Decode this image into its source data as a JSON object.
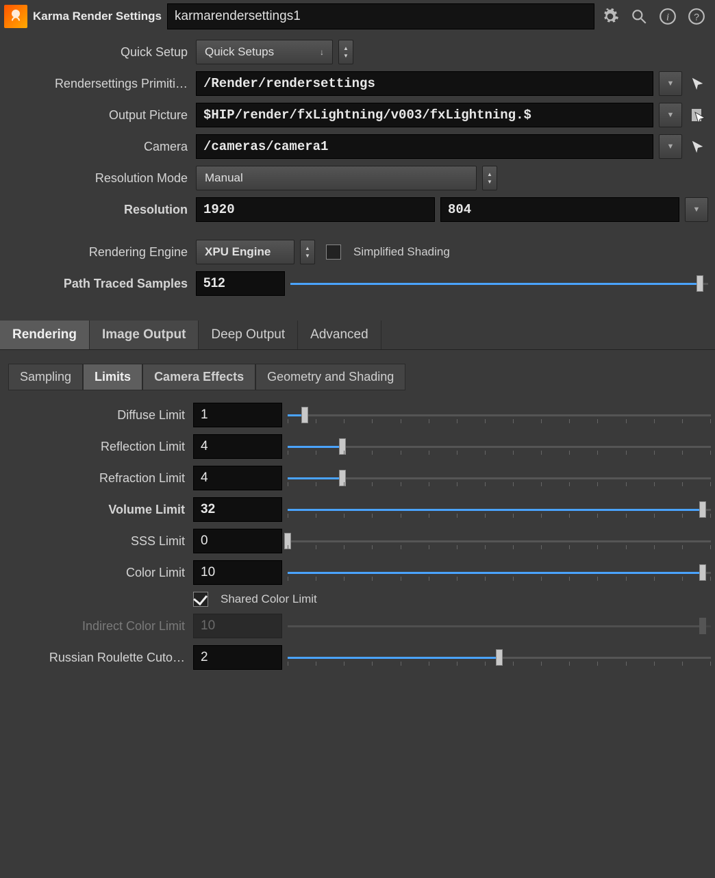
{
  "header": {
    "title": "Karma Render Settings",
    "node_name": "karmarendersettings1"
  },
  "params": {
    "quick_setup_label": "Quick Setup",
    "quick_setup_value": "Quick Setups",
    "rendersettings_label": "Rendersettings Primiti…",
    "rendersettings_value": "/Render/rendersettings",
    "output_picture_label": "Output Picture",
    "output_picture_value": "$HIP/render/fxLightning/v003/fxLightning.$",
    "camera_label": "Camera",
    "camera_value": "/cameras/camera1",
    "resolution_mode_label": "Resolution Mode",
    "resolution_mode_value": "Manual",
    "resolution_label": "Resolution",
    "resolution_x": "1920",
    "resolution_y": "804",
    "rendering_engine_label": "Rendering Engine",
    "rendering_engine_value": "XPU Engine",
    "simplified_shading_label": "Simplified Shading",
    "path_traced_label": "Path Traced Samples",
    "path_traced_value": "512",
    "path_traced_pct": 98
  },
  "tabs": [
    "Rendering",
    "Image Output",
    "Deep Output",
    "Advanced"
  ],
  "active_tab": "Rendering",
  "subtabs": [
    "Sampling",
    "Limits",
    "Camera Effects",
    "Geometry and Shading"
  ],
  "active_subtab": "Limits",
  "limits": {
    "diffuse": {
      "label": "Diffuse Limit",
      "value": "1",
      "pct": 4,
      "bold": false
    },
    "reflection": {
      "label": "Reflection Limit",
      "value": "4",
      "pct": 13,
      "bold": false
    },
    "refraction": {
      "label": "Refraction Limit",
      "value": "4",
      "pct": 13,
      "bold": false
    },
    "volume": {
      "label": "Volume Limit",
      "value": "32",
      "pct": 98,
      "bold": true
    },
    "sss": {
      "label": "SSS Limit",
      "value": "0",
      "pct": 0,
      "bold": false
    },
    "color": {
      "label": "Color Limit",
      "value": "10",
      "pct": 98,
      "bold": false
    },
    "shared_color_label": "Shared Color Limit",
    "shared_color_checked": true,
    "indirect": {
      "label": "Indirect Color Limit",
      "value": "10",
      "pct": 98,
      "disabled": true
    },
    "rr": {
      "label": "Russian Roulette Cuto…",
      "value": "2",
      "pct": 50,
      "bold": false
    }
  }
}
